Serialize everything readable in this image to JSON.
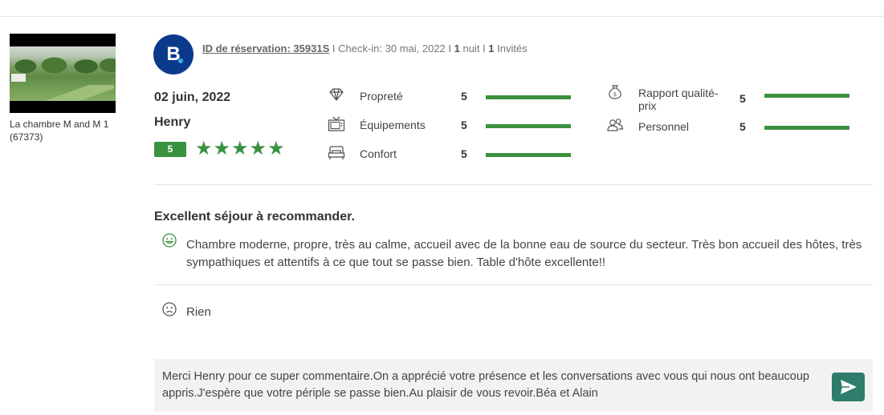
{
  "property": {
    "name": "La chambre M and M 1 (67373)"
  },
  "reservation": {
    "brand_letter": "B",
    "id_label": "ID de réservation: 35931S",
    "sep1": " I ",
    "checkin_label": "Check-in: 30 mai, 2022",
    "sep2": " I ",
    "nights_count": "1",
    "nights_label": " nuit",
    "sep3": " I ",
    "guests_count": "1",
    "guests_label": " Invités"
  },
  "review": {
    "date": "02 juin, 2022",
    "reviewer": "Henry",
    "score": "5",
    "stars": "★★★★★",
    "star_rating": 5,
    "title": "Excellent séjour à recommander.",
    "positive": "Chambre moderne, propre, très au calme, accueil avec de la bonne eau de source du secteur. Très bon accueil des hôtes, très sympathiques et attentifs à ce que tout se passe bien. Table d'hôte excellente!!",
    "negative": "Rien"
  },
  "categories": [
    {
      "icon": "diamond-icon",
      "label": "Propreté",
      "score": "5",
      "fraction": 1.0
    },
    {
      "icon": "tv-icon",
      "label": "Équipements",
      "score": "5",
      "fraction": 1.0
    },
    {
      "icon": "bed-icon",
      "label": "Confort",
      "score": "5",
      "fraction": 1.0
    },
    {
      "icon": "money-bag-icon",
      "label": "Rapport qualité-prix",
      "score": "5",
      "fraction": 1.0
    },
    {
      "icon": "people-icon",
      "label": "Personnel",
      "score": "5",
      "fraction": 1.0
    }
  ],
  "reply": {
    "text": "Merci Henry pour ce super commentaire.On a apprécié votre présence et les conversations avec vous qui nous ont beaucoup appris.J'espère que votre périple se passe bien.Au plaisir de vous revoir.Béa et Alain",
    "send_icon": "send-icon"
  },
  "colors": {
    "accent_green": "#3a913f",
    "brand_blue": "#0b3a8c",
    "send_button": "#2e7d6b"
  }
}
